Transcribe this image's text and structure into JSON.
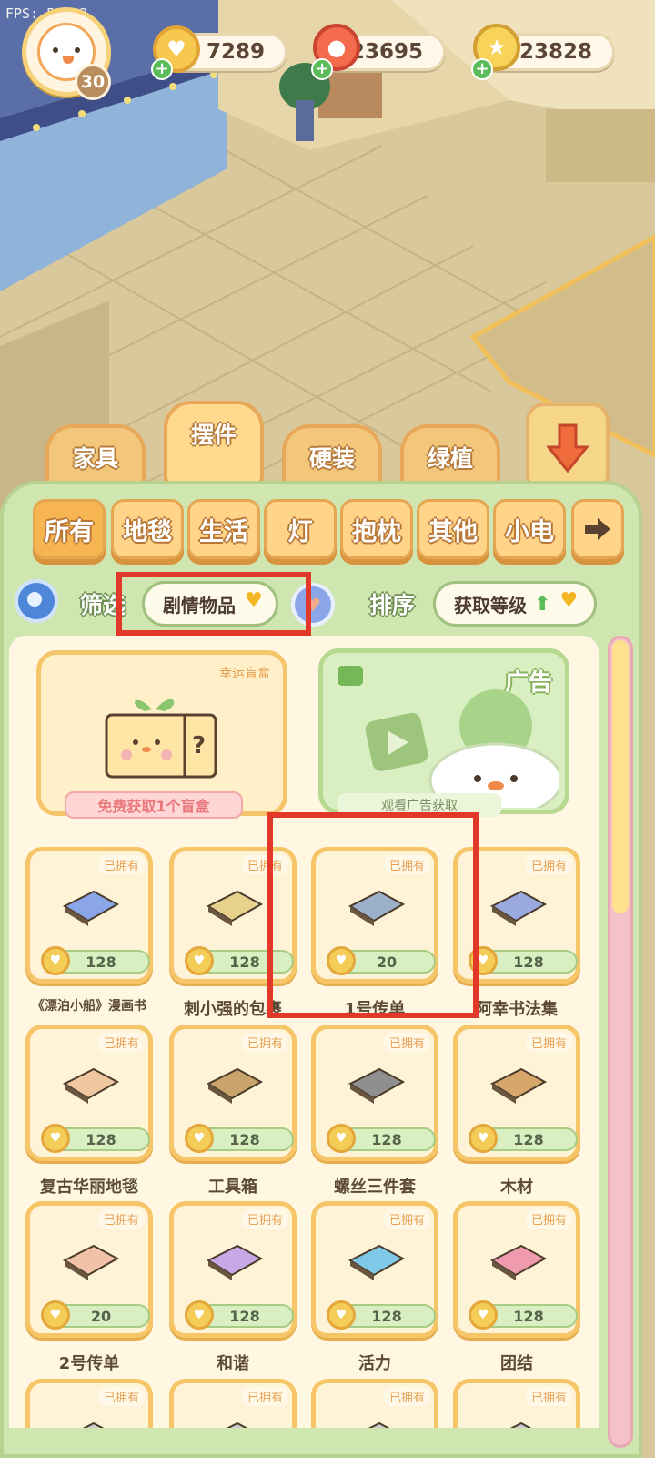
{
  "hud": {
    "fps": "FPS: 53.33",
    "level": "30",
    "currencies": [
      {
        "icon": "heart-coin-icon",
        "value": "7289"
      },
      {
        "icon": "meat-icon",
        "value": "23695"
      },
      {
        "icon": "star-ticket-icon",
        "value": "23828"
      }
    ]
  },
  "tabs": [
    {
      "label": "家具"
    },
    {
      "label": "摆件"
    },
    {
      "label": "硬装"
    },
    {
      "label": "绿植"
    }
  ],
  "sub_tabs": [
    {
      "label": "所有"
    },
    {
      "label": "地毯"
    },
    {
      "label": "生活"
    },
    {
      "label": "灯"
    },
    {
      "label": "抱枕"
    },
    {
      "label": "其他"
    },
    {
      "label": "小电"
    }
  ],
  "filter": {
    "label": "筛选",
    "value": "剧情物品"
  },
  "sort": {
    "label": "排序",
    "value": "获取等级"
  },
  "promo": {
    "lucky_tag": "幸运盲盒",
    "lucky_button": "免费获取1个盲盒",
    "ad_label": "广告",
    "ad_caption": "观看广告获取"
  },
  "items": [
    {
      "name": "《漂泊小船》漫画书",
      "price": "128",
      "owned": "已拥有",
      "icon": "comic-book-icon"
    },
    {
      "name": "刺小强的包裹",
      "price": "128",
      "owned": "已拥有",
      "icon": "parcel-icon"
    },
    {
      "name": "1号传单",
      "price": "20",
      "owned": "已拥有",
      "icon": "flyer-icon"
    },
    {
      "name": "阿幸书法集",
      "price": "128",
      "owned": "已拥有",
      "icon": "calligraphy-book-icon"
    },
    {
      "name": "复古华丽地毯",
      "price": "128",
      "owned": "已拥有",
      "icon": "rug-icon"
    },
    {
      "name": "工具箱",
      "price": "128",
      "owned": "已拥有",
      "icon": "toolbox-icon"
    },
    {
      "name": "螺丝三件套",
      "price": "128",
      "owned": "已拥有",
      "icon": "screws-icon"
    },
    {
      "name": "木材",
      "price": "128",
      "owned": "已拥有",
      "icon": "wood-icon"
    },
    {
      "name": "2号传单",
      "price": "20",
      "owned": "已拥有",
      "icon": "flyer-icon"
    },
    {
      "name": "和谐",
      "price": "128",
      "owned": "已拥有",
      "icon": "word-sign-icon"
    },
    {
      "name": "活力",
      "price": "128",
      "owned": "已拥有",
      "icon": "word-sign-icon"
    },
    {
      "name": "团结",
      "price": "128",
      "owned": "已拥有",
      "icon": "word-sign-icon"
    },
    {
      "name": "",
      "price": "",
      "owned": "已拥有",
      "icon": "item-icon"
    },
    {
      "name": "",
      "price": "",
      "owned": "已拥有",
      "icon": "item-icon"
    },
    {
      "name": "",
      "price": "",
      "owned": "已拥有",
      "icon": "item-icon"
    },
    {
      "name": "",
      "price": "",
      "owned": "已拥有",
      "icon": "item-icon"
    }
  ]
}
